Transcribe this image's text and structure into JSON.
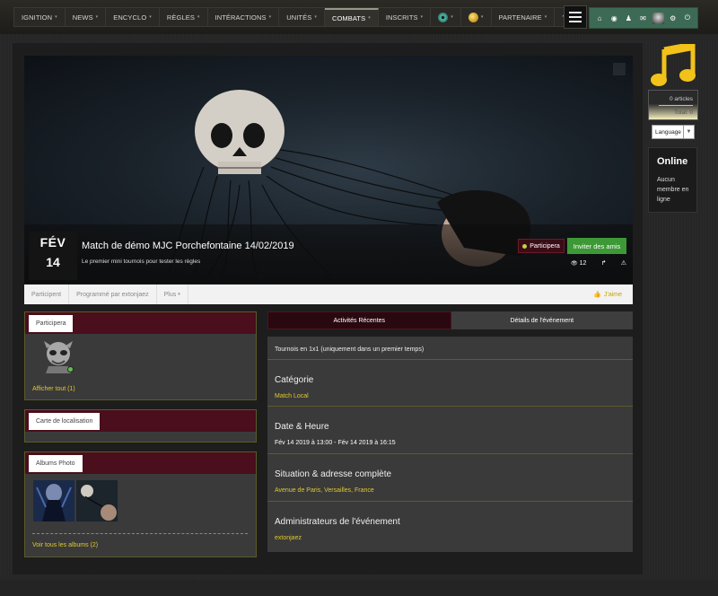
{
  "nav": {
    "items": [
      {
        "label": "IGNITION",
        "caret": "▾",
        "active": false
      },
      {
        "label": "NEWS",
        "caret": "▾",
        "active": false
      },
      {
        "label": "ENCYCLO",
        "caret": "▾",
        "active": false
      },
      {
        "label": "RÈGLES",
        "caret": "▾",
        "active": false
      },
      {
        "label": "INTÉRACTIONS",
        "caret": "▾",
        "active": false
      },
      {
        "label": "UNITÉS",
        "caret": "▾",
        "active": false
      },
      {
        "label": "COMBATS",
        "caret": "▾",
        "active": true
      },
      {
        "label": "INSCRITS",
        "caret": "▾",
        "active": false
      }
    ],
    "partner_label": "PARTENAIRE",
    "help_label": "?",
    "caret": "▾",
    "eye_icon": "eye-icon",
    "coin_icon": "coin-icon"
  },
  "user_menu": {
    "icons": [
      "home-icon",
      "globe-icon",
      "user-icon",
      "mail-icon",
      "avatar",
      "gear-icon",
      "power-icon"
    ],
    "home": "⌂",
    "globe": "◉",
    "user": "♟",
    "mail": "✉",
    "gear": "⚙",
    "power": "⏻"
  },
  "event": {
    "month": "FÉV",
    "day": "14",
    "title": "Match de démo MJC Porchefontaine 14/02/2019",
    "subtitle": "Le premier mini tournois pour tester les règles",
    "participe_label": "Participera",
    "invite_label": "Inviter des amis",
    "views": "12",
    "share_icon": "↱",
    "report_icon": "⚠",
    "eye_icon": "👁"
  },
  "subnav": {
    "items": [
      "Participent",
      "Programmé par extonjaez",
      "Plus"
    ],
    "plus_caret": "▾",
    "like_label": "J'aime",
    "like_icon": "👍"
  },
  "participants_box": {
    "tab": "Participera",
    "show_all": "Afficher tout (1)"
  },
  "map_box": {
    "tab": "Carte de localisation"
  },
  "albums_box": {
    "tab": "Albums Photo",
    "see_all": "Voir tous les albums (2)"
  },
  "tabs": {
    "recent": "Activités Récentes",
    "details": "Détails de l'événement"
  },
  "details": {
    "intro": "Tournois en 1x1 (uniquement dans un premier temps)",
    "category_title": "Catégorie",
    "category_value": "Match Local",
    "date_title": "Date & Heure",
    "date_value": "Fév 14 2019 à 13:00 - Fév 14 2019 à 16:15",
    "address_title": "Situation & adresse complète",
    "address_value": "Avenue de Paris, Versailles, France",
    "admins_title": "Administrateurs de l'événement",
    "admins_value": "extonjaez"
  },
  "sidebar": {
    "articles": "0 articles",
    "total": "Total: 0",
    "language": "Language",
    "lang_caret": "▼",
    "online_title": "Online",
    "online_text": "Aucun membre en ligne",
    "music_icon": "music-note-icon"
  },
  "colors": {
    "accent_green": "#3d9936",
    "dark_red": "#4a0e1c",
    "yellow": "#e0c830",
    "usermenu": "#3d6a55"
  }
}
